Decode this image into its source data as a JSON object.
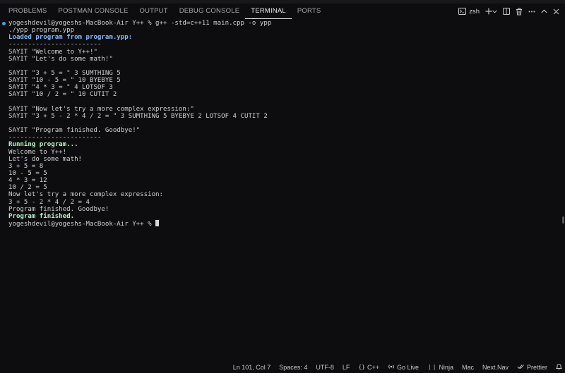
{
  "panel": {
    "tabs": [
      "PROBLEMS",
      "POSTMAN CONSOLE",
      "OUTPUT",
      "DEBUG CONSOLE",
      "TERMINAL",
      "PORTS"
    ],
    "active_tab": "TERMINAL",
    "shell_label": "zsh",
    "tool_icons": [
      "terminal-icon",
      "plus-icon",
      "chevron-down-icon",
      "split-icon",
      "trash-icon",
      "more-icon",
      "maximize-icon",
      "close-icon"
    ]
  },
  "terminal": {
    "lines": [
      {
        "text": "yogeshdevil@yogeshs-MacBook-Air Y++ % g++ -std=c++11 main.cpp -o ypp",
        "style": "prompt"
      },
      {
        "text": "./ypp program.ypp",
        "style": ""
      },
      {
        "text": "Loaded program from program.ypp:",
        "style": "blue-bold"
      },
      {
        "text": "------------------------",
        "style": ""
      },
      {
        "text": "SAYIT \"Welcome to Y++!\"",
        "style": ""
      },
      {
        "text": "SAYIT \"Let's do some math!\"",
        "style": ""
      },
      {
        "text": "",
        "style": ""
      },
      {
        "text": "SAYIT \"3 + 5 = \" 3 SUMTHING 5",
        "style": ""
      },
      {
        "text": "SAYIT \"10 - 5 = \" 10 BYEBYE 5",
        "style": ""
      },
      {
        "text": "SAYIT \"4 * 3 = \" 4 LOTSOF 3",
        "style": ""
      },
      {
        "text": "SAYIT \"10 / 2 = \" 10 CUTIT 2",
        "style": ""
      },
      {
        "text": "",
        "style": ""
      },
      {
        "text": "SAYIT \"Now let's try a more complex expression:\"",
        "style": ""
      },
      {
        "text": "SAYIT \"3 + 5 - 2 * 4 / 2 = \" 3 SUMTHING 5 BYEBYE 2 LOTSOF 4 CUTIT 2",
        "style": ""
      },
      {
        "text": "",
        "style": ""
      },
      {
        "text": "SAYIT \"Program finished. Goodbye!\"",
        "style": ""
      },
      {
        "text": "------------------------",
        "style": ""
      },
      {
        "text": "Running program...",
        "style": "green-bold"
      },
      {
        "text": "Welcome to Y++!",
        "style": ""
      },
      {
        "text": "Let's do some math!",
        "style": ""
      },
      {
        "text": "3 + 5 = 8",
        "style": ""
      },
      {
        "text": "10 - 5 = 5",
        "style": ""
      },
      {
        "text": "4 * 3 = 12",
        "style": ""
      },
      {
        "text": "10 / 2 = 5",
        "style": ""
      },
      {
        "text": "Now let's try a more complex expression:",
        "style": ""
      },
      {
        "text": "3 + 5 - 2 * 4 / 2 = 4",
        "style": ""
      },
      {
        "text": "Program finished. Goodbye!",
        "style": ""
      },
      {
        "text": "Program finished.",
        "style": "green-bold"
      },
      {
        "text": "yogeshdevil@yogeshs-MacBook-Air Y++ % ",
        "style": "cursor"
      }
    ]
  },
  "statusbar": {
    "position": "Ln 101, Col 7",
    "spaces": "Spaces: 4",
    "encoding": "UTF-8",
    "eol": "LF",
    "language": "C++",
    "golive": "Go Live",
    "ninja": "Ninja",
    "mac": "Mac",
    "nextnav": "Next.Nav",
    "prettier": "Prettier"
  },
  "colors": {
    "background": "#0d0d0f",
    "prompt_dot": "#4c9be8",
    "loaded_text": "#7fb8ff",
    "running_text": "#b8f2c5"
  }
}
